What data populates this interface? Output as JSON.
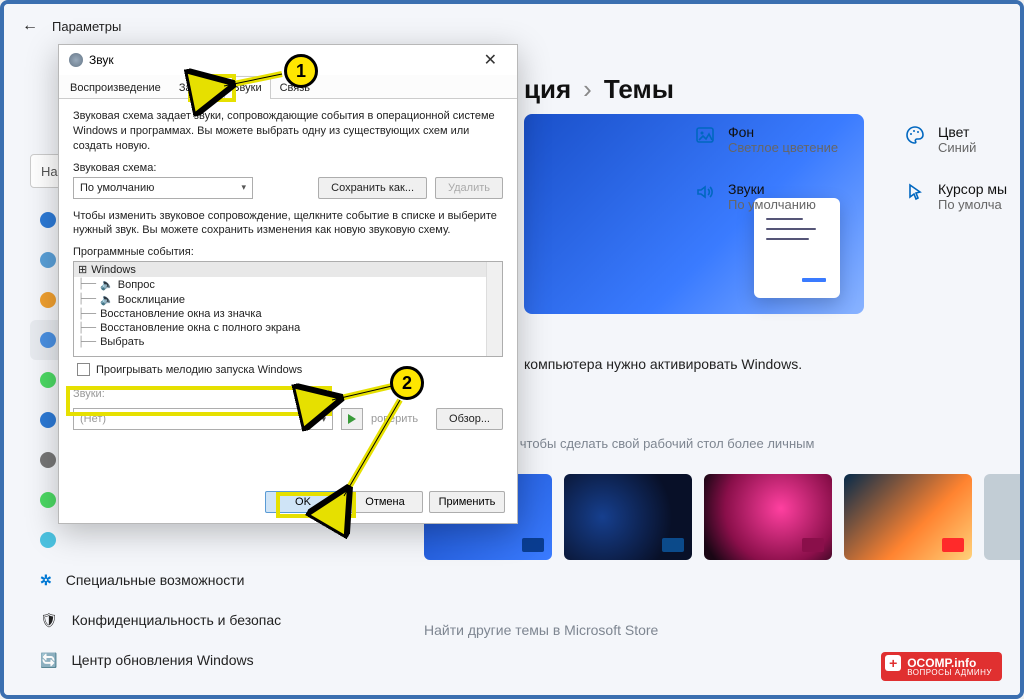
{
  "header": {
    "app": "Параметры"
  },
  "breadcrumb": {
    "partial": "ция",
    "page": "Темы"
  },
  "cards": {
    "bg": {
      "title": "Фон",
      "value": "Светлое цветение"
    },
    "color": {
      "title": "Цвет",
      "value": "Синий"
    },
    "sound": {
      "title": "Звуки",
      "value": "По умолчанию"
    },
    "cursor": {
      "title": "Курсор мы",
      "value": "По умолча"
    }
  },
  "activate_hint": "компьютера нужно активировать Windows.",
  "themes_tip": "вуков и цветов, чтобы сделать свой рабочий стол более личным",
  "store_link": "Найти другие темы в Microsoft Store",
  "search_placeholder": "На",
  "sidebar": {
    "items": [
      "Специальные возможности",
      "Конфиденциальность и безопас",
      "Центр обновления Windows"
    ]
  },
  "dialog": {
    "title": "Звук",
    "tabs": [
      "Воспроизведение",
      "Запись",
      "Звуки",
      "Связь"
    ],
    "active_tab": 2,
    "intro": "Звуковая схема задает звуки, сопровождающие события в операционной системе Windows и программах. Вы можете выбрать одну из существующих схем или создать новую.",
    "scheme_label": "Звуковая схема:",
    "scheme_value": "По умолчанию",
    "save_as": "Сохранить как...",
    "delete": "Удалить",
    "events_help": "Чтобы изменить звуковое сопровождение, щелкните событие в списке и выберите нужный звук. Вы можете сохранить изменения как новую звуковую схему.",
    "events_label": "Программные события:",
    "events": [
      "Windows",
      "Вопрос",
      "Восклицание",
      "Восстановление окна из значка",
      "Восстановление окна с полного экрана",
      "Выбрать"
    ],
    "startup_checkbox": "Проигрывать мелодию запуска Windows",
    "sounds_label": "Звуки:",
    "sounds_value": "(Нет)",
    "test": "роверить",
    "browse": "Обзор...",
    "ok": "OK",
    "cancel": "Отмена",
    "apply": "Применить"
  },
  "annotations": {
    "n1": "1",
    "n2": "2"
  },
  "watermark": {
    "brand": "OCOMP.info",
    "sub": "ВОПРОСЫ АДМИНУ"
  }
}
